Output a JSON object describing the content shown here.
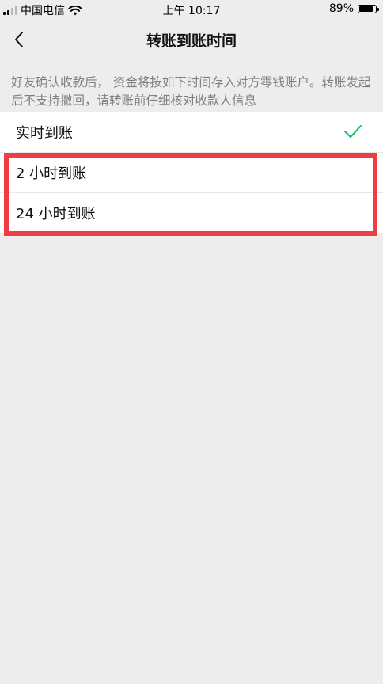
{
  "status_bar": {
    "carrier": "中国电信",
    "time": "上午 10:17",
    "battery": "89%",
    "battery_level": 0.89
  },
  "nav": {
    "title": "转账到账时间"
  },
  "description": "好友确认收款后， 资金将按如下时间存入对方零钱账户。转账发起后不支持撤回，请转账前仔细核对收款人信息",
  "options": [
    {
      "label": "实时到账",
      "selected": true
    },
    {
      "label": "2 小时到账",
      "selected": false
    },
    {
      "label": "24 小时到账",
      "selected": false
    }
  ],
  "colors": {
    "check": "#07c160",
    "highlight": "#ee3d43",
    "background": "#ededed"
  }
}
